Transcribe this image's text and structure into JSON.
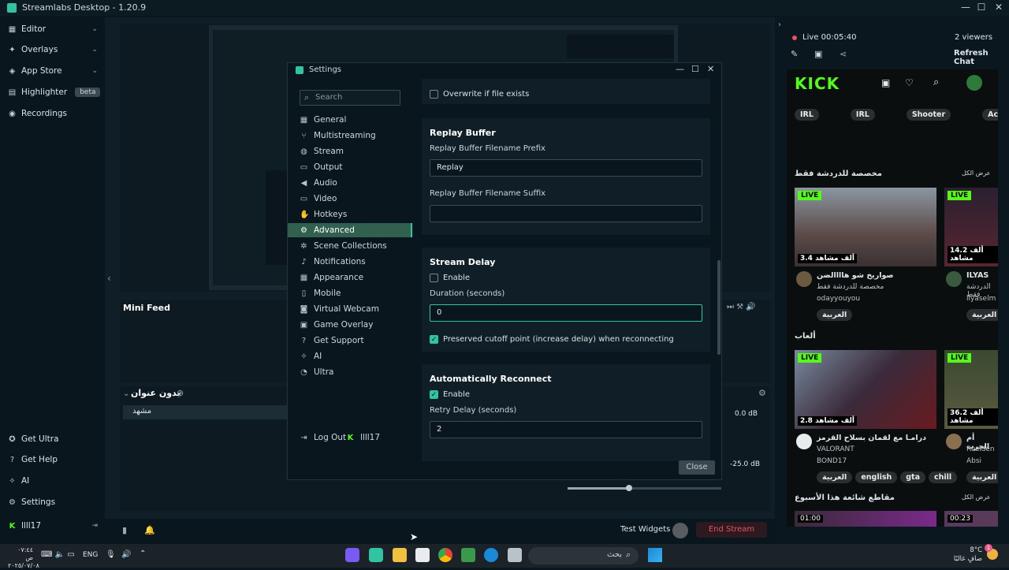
{
  "app": {
    "title": "Streamlabs Desktop - 1.20.9"
  },
  "nav": {
    "items": [
      {
        "label": "Editor",
        "icon": "editor-icon"
      },
      {
        "label": "Overlays",
        "icon": "overlays-icon"
      },
      {
        "label": "App Store",
        "icon": "app-store-icon"
      },
      {
        "label": "Highlighter",
        "badge": "beta",
        "icon": "highlighter-icon"
      },
      {
        "label": "Recordings",
        "icon": "recordings-icon"
      }
    ],
    "bottom": [
      {
        "label": "Get Ultra"
      },
      {
        "label": "Get Help"
      },
      {
        "label": "AI"
      },
      {
        "label": "Settings"
      },
      {
        "label": "llll17"
      }
    ]
  },
  "editor": {
    "minifeed_title": "Mini Feed",
    "scene_collection": "بدون عنوان",
    "scene_item": "مشهد",
    "db1": "0.0 dB",
    "db2": "-25.0 dB",
    "test_widgets": "Test Widgets",
    "end_stream": "End Stream"
  },
  "chat": {
    "live_time": "Live 00:05:40",
    "viewers": "2 viewers",
    "refresh": "Refresh Chat",
    "kick_logo": "KICK",
    "tags_top": [
      "IRL",
      "IRL",
      "Shooter",
      "Ac"
    ],
    "section1": "مخصصة للدردشة فقط",
    "see_all1": "عرض الكل",
    "stream1": {
      "title": "صواريخ شو هاااالضن",
      "sub": "مخصصة للدردشة فقط",
      "user": "odayyouyou",
      "viewers": "3.4 ألف مشاهد",
      "tag": "العربية"
    },
    "stream2": {
      "title": "ILYAS",
      "sub": "الدردشة فقط",
      "user": "ilyaselm",
      "viewers": "14.2 ألف مشاهد",
      "tag": "العربية"
    },
    "section2": "ألعاب",
    "stream3": {
      "title": "درامـا مع لقمان بسلاح القرمز",
      "sub": "VALORANT",
      "user": "BOND17",
      "viewers": "2.8 ألف مشاهد",
      "tags": [
        "العربية",
        "english",
        "gta",
        "chill"
      ]
    },
    "stream4": {
      "title": "أم الحرب",
      "sub": "Residen",
      "user": "Absi",
      "viewers": "36.2 ألف مشاهد",
      "tag": "العربية"
    },
    "section3": "مقاطع شائعة هذا الأسبوع",
    "see_all3": "عرض الكل",
    "clip1": "01:00",
    "clip2": "00:23",
    "live_label": "LIVE"
  },
  "settings": {
    "title": "Settings",
    "search_placeholder": "Search",
    "categories": [
      "General",
      "Multistreaming",
      "Stream",
      "Output",
      "Audio",
      "Video",
      "Hotkeys",
      "Advanced",
      "Scene Collections",
      "Notifications",
      "Appearance",
      "Mobile",
      "Virtual Webcam",
      "Game Overlay",
      "Get Support",
      "AI",
      "Ultra"
    ],
    "active_category": "Advanced",
    "logout": "Log Out",
    "user": "llll17",
    "overwrite_label": "Overwrite if file exists",
    "replay_buffer": {
      "title": "Replay Buffer",
      "prefix_label": "Replay Buffer Filename Prefix",
      "prefix_value": "Replay",
      "suffix_label": "Replay Buffer Filename Suffix",
      "suffix_value": ""
    },
    "stream_delay": {
      "title": "Stream Delay",
      "enable": "Enable",
      "duration_label": "Duration (seconds)",
      "duration_value": "0",
      "preserve_label": "Preserved cutoff point (increase delay) when reconnecting"
    },
    "reconnect": {
      "title": "Automatically Reconnect",
      "enable": "Enable",
      "retry_label": "Retry Delay (seconds)",
      "retry_value": "2"
    },
    "close": "Close"
  },
  "taskbar": {
    "time": "٠٧:٤٤ ص",
    "date": "٢٠٢٥/٠٧/٠٨",
    "lang": "ENG",
    "search": "بحث",
    "weather_temp": "8°C",
    "weather_desc": "صافٍ غالبًا",
    "notif_count": "1"
  },
  "colors": {
    "accent": "#31c3a2",
    "kick_green": "#53fc18",
    "end_stream": "#e8525e"
  }
}
